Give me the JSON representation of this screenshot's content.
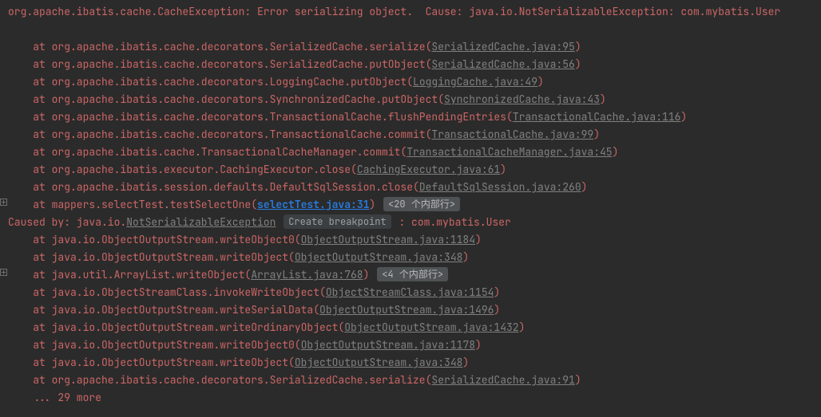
{
  "header": "org.apache.ibatis.cache.CacheException: Error serializing object.  Cause: java.io.NotSerializableException: com.mybatis.User",
  "frames1": [
    {
      "prefix": "at org.apache.ibatis.cache.decorators.SerializedCache.serialize(",
      "link": "SerializedCache.java:95",
      "suffix": ")"
    },
    {
      "prefix": "at org.apache.ibatis.cache.decorators.SerializedCache.putObject(",
      "link": "SerializedCache.java:56",
      "suffix": ")"
    },
    {
      "prefix": "at org.apache.ibatis.cache.decorators.LoggingCache.putObject(",
      "link": "LoggingCache.java:49",
      "suffix": ")"
    },
    {
      "prefix": "at org.apache.ibatis.cache.decorators.SynchronizedCache.putObject(",
      "link": "SynchronizedCache.java:43",
      "suffix": ")"
    },
    {
      "prefix": "at org.apache.ibatis.cache.decorators.TransactionalCache.flushPendingEntries(",
      "link": "TransactionalCache.java:116",
      "suffix": ")"
    },
    {
      "prefix": "at org.apache.ibatis.cache.decorators.TransactionalCache.commit(",
      "link": "TransactionalCache.java:99",
      "suffix": ")"
    },
    {
      "prefix": "at org.apache.ibatis.cache.TransactionalCacheManager.commit(",
      "link": "TransactionalCacheManager.java:45",
      "suffix": ")"
    },
    {
      "prefix": "at org.apache.ibatis.executor.CachingExecutor.close(",
      "link": "CachingExecutor.java:61",
      "suffix": ")"
    },
    {
      "prefix": "at org.apache.ibatis.session.defaults.DefaultSqlSession.close(",
      "link": "DefaultSqlSession.java:260",
      "suffix": ")"
    }
  ],
  "userFrame": {
    "prefix": "at mappers.selectTest.testSelectOne(",
    "link": "selectTest.java:31",
    "suffix": ")",
    "badge": "<20 个内部行>"
  },
  "cause": {
    "pre": "Caused by: java.io.",
    "cls": "NotSerializableException",
    "bp": "Create breakpoint",
    "post": ": com.mybatis.User"
  },
  "frames2a": [
    {
      "prefix": "at java.io.ObjectOutputStream.writeObject0(",
      "link": "ObjectOutputStream.java:1184",
      "suffix": ")"
    },
    {
      "prefix": "at java.io.ObjectOutputStream.writeObject(",
      "link": "ObjectOutputStream.java:348",
      "suffix": ")"
    }
  ],
  "arrayFrame": {
    "prefix": "at java.util.ArrayList.writeObject(",
    "link": "ArrayList.java:768",
    "suffix": ")",
    "badge": "<4 个内部行>"
  },
  "frames2b": [
    {
      "prefix": "at java.io.ObjectStreamClass.invokeWriteObject(",
      "link": "ObjectStreamClass.java:1154",
      "suffix": ")"
    },
    {
      "prefix": "at java.io.ObjectOutputStream.writeSerialData(",
      "link": "ObjectOutputStream.java:1496",
      "suffix": ")"
    },
    {
      "prefix": "at java.io.ObjectOutputStream.writeOrdinaryObject(",
      "link": "ObjectOutputStream.java:1432",
      "suffix": ")"
    },
    {
      "prefix": "at java.io.ObjectOutputStream.writeObject0(",
      "link": "ObjectOutputStream.java:1178",
      "suffix": ")"
    },
    {
      "prefix": "at java.io.ObjectOutputStream.writeObject(",
      "link": "ObjectOutputStream.java:348",
      "suffix": ")"
    },
    {
      "prefix": "at org.apache.ibatis.cache.decorators.SerializedCache.serialize(",
      "link": "SerializedCache.java:91",
      "suffix": ")"
    }
  ],
  "more": "... 29 more"
}
